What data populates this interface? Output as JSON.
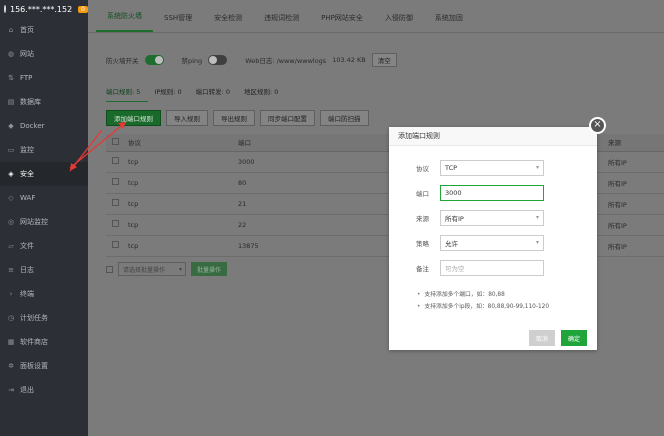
{
  "sidebar": {
    "server": "156.***.***.152",
    "badge": "0",
    "items": [
      {
        "label": "首页",
        "icon": "home-icon"
      },
      {
        "label": "网站",
        "icon": "globe-icon"
      },
      {
        "label": "FTP",
        "icon": "ftp-icon"
      },
      {
        "label": "数据库",
        "icon": "database-icon"
      },
      {
        "label": "Docker",
        "icon": "docker-icon"
      },
      {
        "label": "监控",
        "icon": "monitor-icon"
      },
      {
        "label": "安全",
        "icon": "shield-icon"
      },
      {
        "label": "WAF",
        "icon": "waf-icon"
      },
      {
        "label": "网站监控",
        "icon": "site-monitor-icon"
      },
      {
        "label": "文件",
        "icon": "folder-icon"
      },
      {
        "label": "日志",
        "icon": "log-icon"
      },
      {
        "label": "终端",
        "icon": "terminal-icon"
      },
      {
        "label": "计划任务",
        "icon": "clock-icon"
      },
      {
        "label": "软件商店",
        "icon": "store-icon"
      },
      {
        "label": "面板设置",
        "icon": "gear-icon"
      },
      {
        "label": "退出",
        "icon": "logout-icon"
      }
    ]
  },
  "tabs": [
    "系统防火墙",
    "SSH管理",
    "安全检测",
    "违规词检测",
    "PHP网站安全",
    "入侵防御",
    "系统加固"
  ],
  "controls": {
    "firewall_label": "防火墙开关",
    "ping_label": "禁ping",
    "weblog_label": "Web日志: /www/wwwlogs",
    "weblog_size": "103.42 KB",
    "clear_button": "清空"
  },
  "subtabs": [
    "端口规则: 5",
    "IP规则: 0",
    "端口转发: 0",
    "地区规则: 0"
  ],
  "actions": [
    "添加端口规则",
    "导入规则",
    "导出规则",
    "同步端口配置",
    "端口防扫描"
  ],
  "table": {
    "headers": [
      "协议",
      "端口",
      "来源"
    ],
    "rows": [
      {
        "protocol": "tcp",
        "port": "3000",
        "source": "所有IP"
      },
      {
        "protocol": "tcp",
        "port": "80",
        "source": "所有IP"
      },
      {
        "protocol": "tcp",
        "port": "21",
        "source": "所有IP"
      },
      {
        "protocol": "tcp",
        "port": "22",
        "source": "所有IP"
      },
      {
        "protocol": "tcp",
        "port": "13875",
        "source": "所有IP"
      }
    ]
  },
  "bottom": {
    "batch_placeholder": "请选择批量操作",
    "batch_button": "批量操作"
  },
  "modal": {
    "title": "添加端口规则",
    "fields": [
      {
        "label": "协议",
        "value": "TCP",
        "type": "select"
      },
      {
        "label": "端口",
        "value": "3000",
        "type": "input"
      },
      {
        "label": "来源",
        "value": "所有IP",
        "type": "select"
      },
      {
        "label": "策略",
        "value": "允许",
        "type": "select"
      },
      {
        "label": "备注",
        "placeholder": "可为空",
        "type": "input"
      }
    ],
    "tips": [
      "支持添加多个端口，如：80,88",
      "支持添加多个ip段，如：80,88,90-99,110-120"
    ],
    "cancel": "取消",
    "confirm": "确定"
  },
  "colors": {
    "accent": "#20a53a",
    "sidebar_bg": "#2c3036",
    "annotation_arrow": "#e53935"
  }
}
